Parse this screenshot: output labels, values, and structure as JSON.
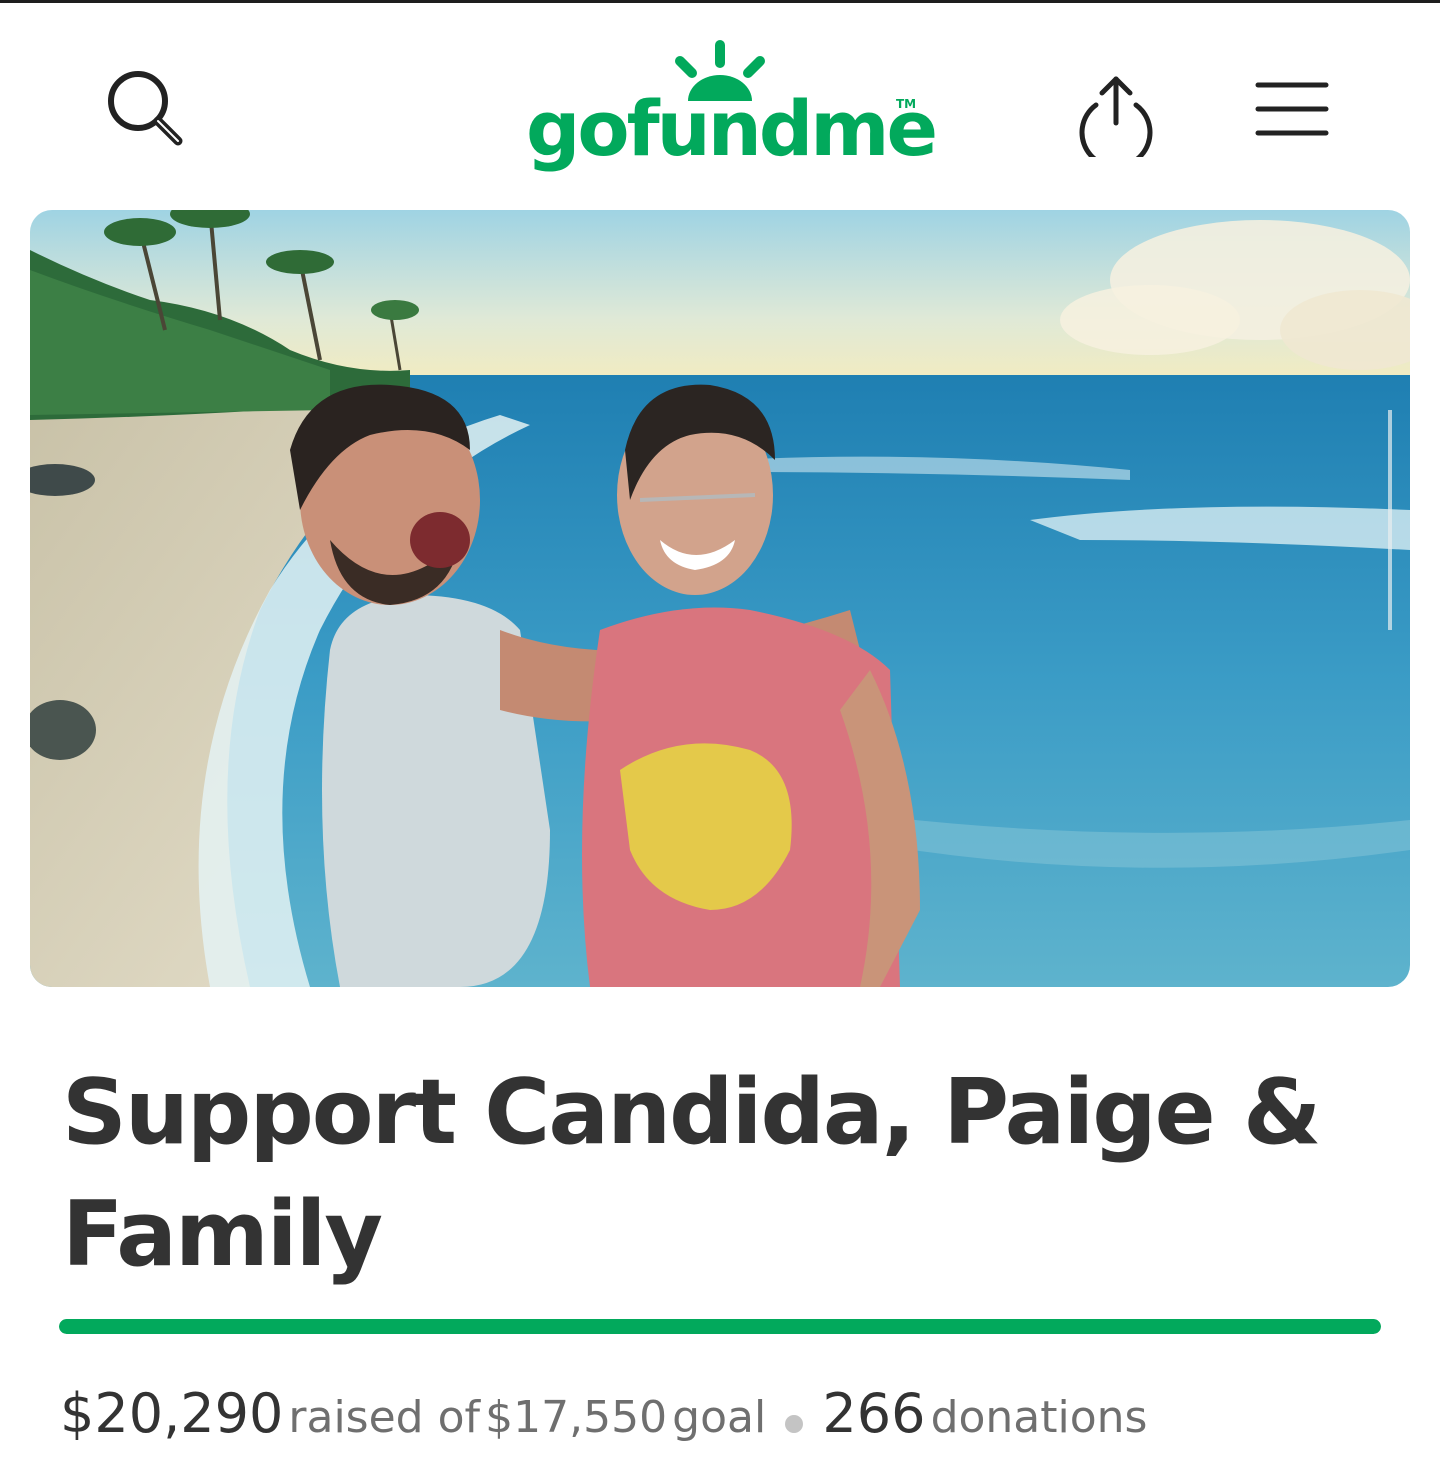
{
  "brand": {
    "logo_text": "gofundme",
    "trademark": "TM",
    "color": "#02a95c"
  },
  "header": {
    "left_icon": "search-icon",
    "right_icons": [
      "share-icon",
      "menu-icon"
    ]
  },
  "campaign": {
    "title": "Support Candida, Paige & Family",
    "raised_amount": "$20,290",
    "raised_label": "raised of",
    "goal_amount": "$17,550",
    "goal_label": "goal",
    "donation_count": "266",
    "donations_label": "donations",
    "progress_fraction": 1.0
  },
  "photo": {
    "description_icon": "campaign-photo"
  }
}
